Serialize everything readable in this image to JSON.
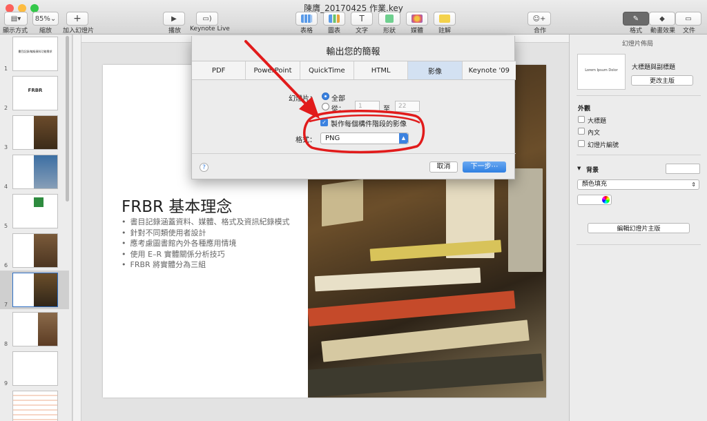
{
  "window": {
    "title": "陳膺_20170425 作業.key"
  },
  "toolbar": {
    "left": [
      {
        "name": "view",
        "label": "顯示方式"
      },
      {
        "name": "zoom",
        "label": "縮放",
        "value": "85%"
      },
      {
        "name": "add-slide",
        "label": "加入幻燈片"
      }
    ],
    "center": [
      {
        "name": "play",
        "label": "播放"
      },
      {
        "name": "keynote-live",
        "label": "Keynote Live"
      }
    ],
    "insert": [
      {
        "name": "table",
        "label": "表格"
      },
      {
        "name": "chart",
        "label": "圖表"
      },
      {
        "name": "text",
        "label": "文字"
      },
      {
        "name": "shape",
        "label": "形狀"
      },
      {
        "name": "media",
        "label": "媒體"
      },
      {
        "name": "comment",
        "label": "註解"
      }
    ],
    "collaborate": "合作",
    "right": [
      {
        "name": "format",
        "label": "格式"
      },
      {
        "name": "animate",
        "label": "動畫效果"
      },
      {
        "name": "document",
        "label": "文件"
      }
    ]
  },
  "navigator": {
    "slides": [
      {
        "num": "1",
        "title": "書目記錄/編級資料功能需求"
      },
      {
        "num": "2",
        "title": "FRBR"
      },
      {
        "num": "3",
        "title": ""
      },
      {
        "num": "4",
        "title": ""
      },
      {
        "num": "5",
        "title": ""
      },
      {
        "num": "6",
        "title": ""
      },
      {
        "num": "7",
        "title": "FRBR 基本理念"
      },
      {
        "num": "8",
        "title": ""
      },
      {
        "num": "9",
        "title": ""
      }
    ]
  },
  "slide": {
    "title": "FRBR 基本理念",
    "bullets": [
      "書目記錄涵蓋資料、媒體、格式及資訊紀錄模式",
      "針對不同類使用者設計",
      "應考慮圖書館內外各種應用情境",
      "使用 E–R 實體關係分析技巧",
      "FRBR 將實體分為三組"
    ]
  },
  "inspector": {
    "header": "幻燈片佈局",
    "master_thumb_text": "Lorem Ipsum Dolor",
    "master_name": "大標題與副標題",
    "change_master": "更改主版",
    "appearance_heading": "外觀",
    "checkboxes": [
      "大標題",
      "內文",
      "幻燈片編號"
    ],
    "background_heading": "背景",
    "fill_type": "顏色填充",
    "edit_master": "編輯幻燈片主版"
  },
  "dialog": {
    "title": "輸出您的簡報",
    "tabs": [
      "PDF",
      "PowerPoint",
      "QuickTime",
      "HTML",
      "影像",
      "Keynote '09"
    ],
    "selected_tab": "影像",
    "slides_label": "幻燈片：",
    "all_label": "全部",
    "from_label": "從：",
    "from_value": "1",
    "to_label": "至",
    "to_value": "22",
    "build_stages_label": "製作每個構件階段的影像",
    "format_label": "格式：",
    "format_value": "PNG",
    "help": "?",
    "cancel": "取消",
    "next": "下一步⋯"
  },
  "colors": {
    "accent": "#3b82e0",
    "annotation": "#e11b1b",
    "traffic": [
      "#fc605b",
      "#fdbc40",
      "#34c84a"
    ]
  }
}
